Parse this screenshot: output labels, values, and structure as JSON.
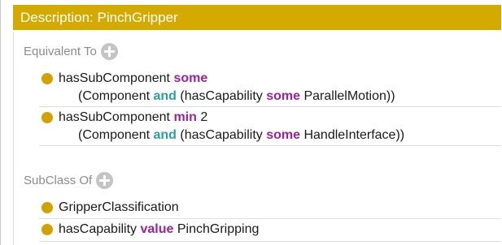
{
  "title": "Description: PinchGripper",
  "equivalent_to": {
    "label": "Equivalent To",
    "add_icon": "plus-circle-icon",
    "items": [
      {
        "line1": {
          "prop": "hasSubComponent ",
          "kw": "some",
          "rest": ""
        },
        "line2": {
          "open": "(Component ",
          "kw1": "and",
          "mid": " (hasCapability ",
          "kw2": "some",
          "close": " ParallelMotion))"
        }
      },
      {
        "line1": {
          "prop": "hasSubComponent ",
          "kw": "min",
          "rest": " 2"
        },
        "line2": {
          "open": "(Component ",
          "kw1": "and",
          "mid": " (hasCapability ",
          "kw2": "some",
          "close": " HandleInterface))"
        }
      }
    ]
  },
  "subclass_of": {
    "label": "SubClass Of",
    "add_icon": "plus-circle-icon",
    "items": [
      {
        "prop": "GripperClassification",
        "kw": "",
        "rest": ""
      },
      {
        "prop": "hasCapability ",
        "kw": "value",
        "rest": " PinchGripping"
      }
    ]
  },
  "colors": {
    "title_bar": "#d4a900",
    "bullet": "#d4a200",
    "keyword_purple": "#a020a0",
    "keyword_teal": "#2a9fa0",
    "section_label": "#8c8c8c"
  }
}
